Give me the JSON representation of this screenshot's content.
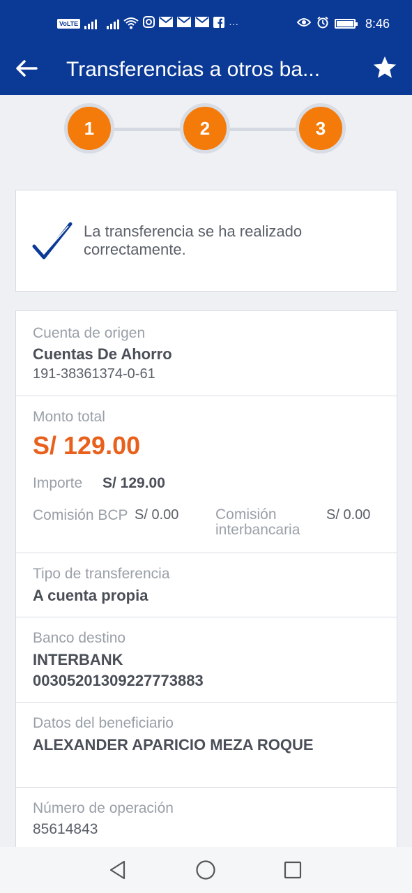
{
  "status": {
    "volte": "VoLTE",
    "time": "8:46",
    "more": "···"
  },
  "appbar": {
    "title": "Transferencias a otros ba..."
  },
  "steps": [
    "1",
    "2",
    "3"
  ],
  "success": {
    "message": "La transferencia se ha realizado correctamente."
  },
  "origin": {
    "label": "Cuenta de origen",
    "account_type": "Cuentas De Ahorro",
    "account_number": "191-38361374-0-61"
  },
  "total": {
    "label": "Monto total",
    "amount": "S/ 129.00",
    "importe_label": "Importe",
    "importe_value": "S/ 129.00",
    "bcp_label": "Comisión BCP",
    "bcp_value": "S/ 0.00",
    "inter_label": "Comisión interbancaria",
    "inter_value": "S/ 0.00"
  },
  "transfer_type": {
    "label": "Tipo de transferencia",
    "value": "A cuenta propia"
  },
  "destination": {
    "label": "Banco destino",
    "bank": "INTERBANK",
    "account": "00305201309227773883"
  },
  "beneficiary": {
    "label": "Datos del beneficiario",
    "name": "ALEXANDER APARICIO MEZA ROQUE"
  },
  "operation": {
    "label": "Número de operación",
    "number": "85614843"
  },
  "colors": {
    "brand_blue": "#0b3a96",
    "accent_orange": "#f47b09",
    "amount_orange": "#e8601b"
  },
  "icons": {
    "back": "back-arrow-icon",
    "favorite": "star-icon",
    "success": "checkmark-icon",
    "nav_back": "triangle-back-icon",
    "nav_home": "circle-home-icon",
    "nav_recents": "square-recents-icon"
  }
}
